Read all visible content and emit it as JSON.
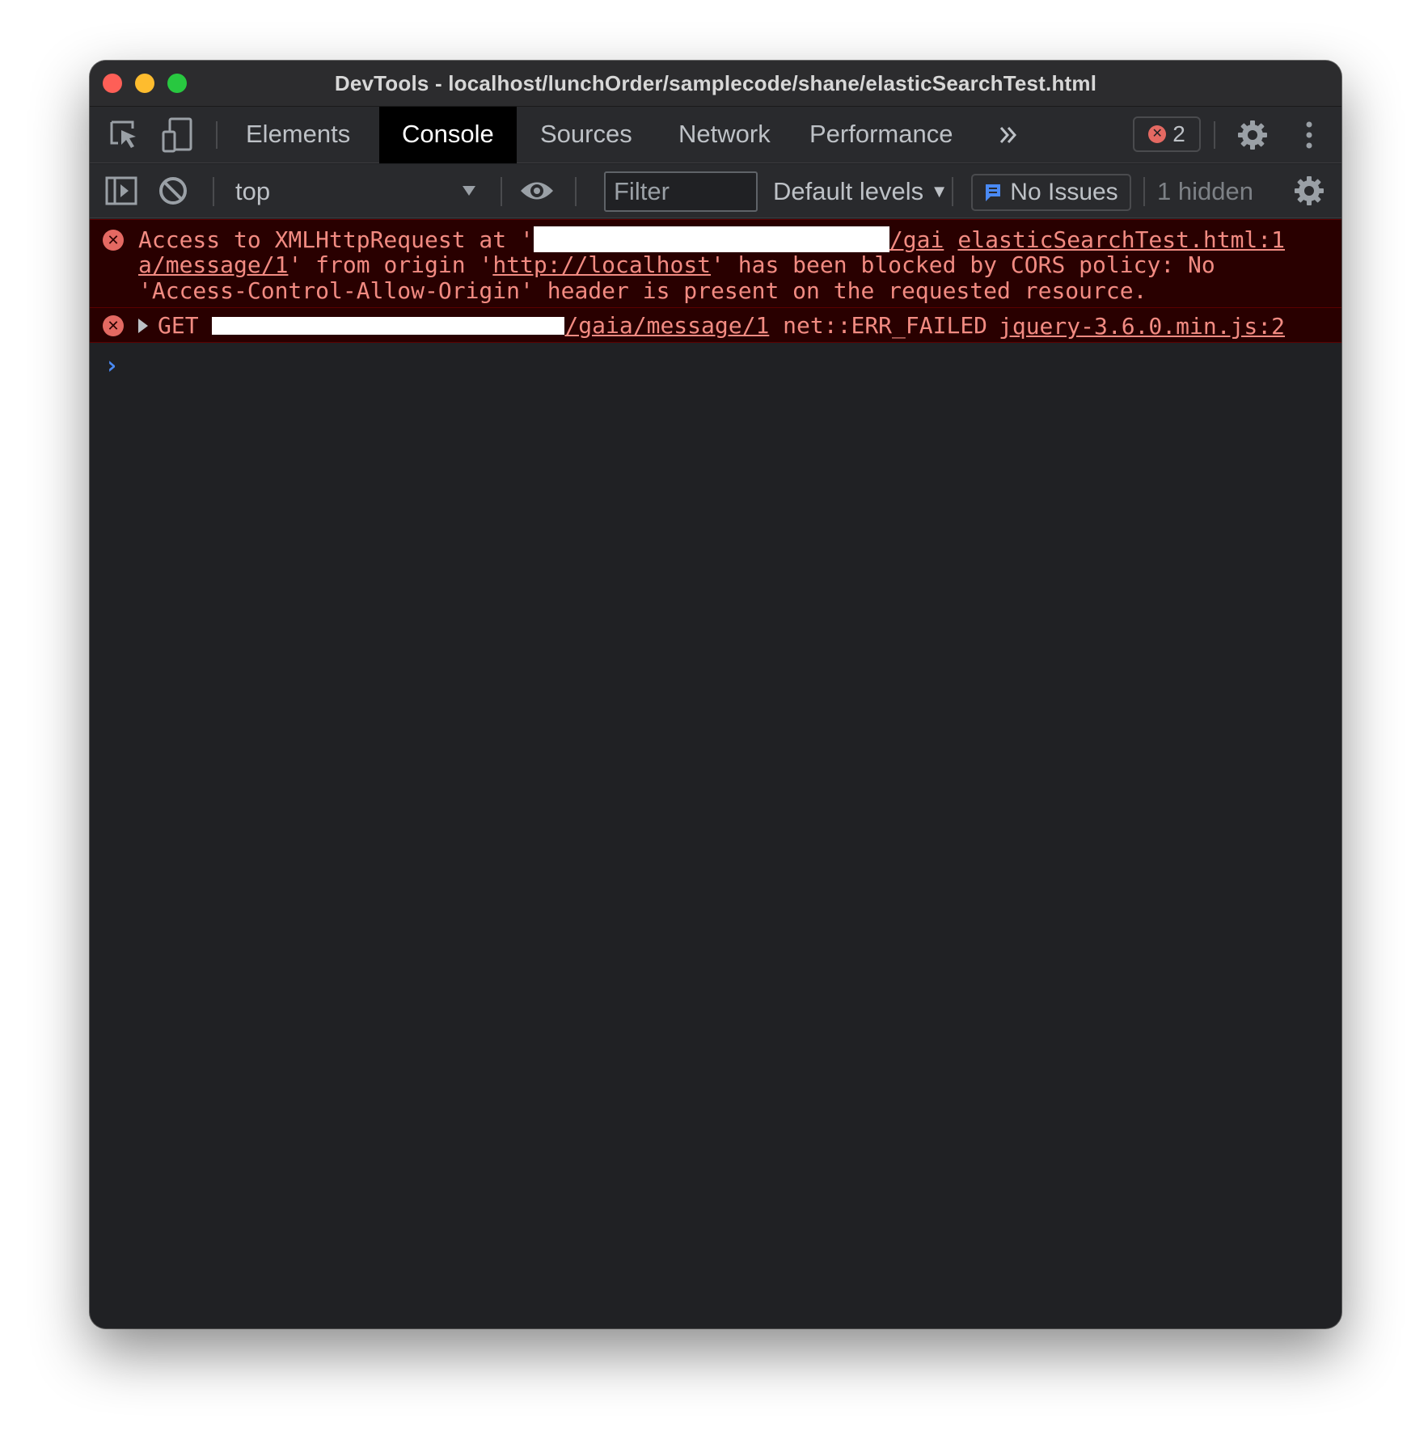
{
  "window": {
    "title": "DevTools - localhost/lunchOrder/samplecode/shane/elasticSearchTest.html"
  },
  "tabs": [
    {
      "label": "Elements",
      "active": false
    },
    {
      "label": "Console",
      "active": true
    },
    {
      "label": "Sources",
      "active": false
    },
    {
      "label": "Network",
      "active": false
    },
    {
      "label": "Performance",
      "active": false
    }
  ],
  "toolbar": {
    "more_tabs_icon": "chevrons-right-icon",
    "error_count": "2",
    "context": "top",
    "filter_placeholder": "Filter",
    "levels": "Default levels",
    "issues": "No Issues",
    "hidden": "1 hidden"
  },
  "messages": [
    {
      "level": "error",
      "line1_prefix": "Access to XMLHttpRequest at '",
      "line1_url_tail": "/gai",
      "line2_url": "a/message/1",
      "line2_mid": "' from origin '",
      "line2_origin": "http://localhost",
      "line2_suffix": "' has been blocked by CORS policy: No",
      "line3": "'Access-Control-Allow-Origin' header is present on the requested resource.",
      "source": "elasticSearchTest.html:1"
    },
    {
      "level": "error",
      "method": "GET",
      "url_tail": "/gaia/message/1",
      "error": "net::ERR_FAILED",
      "source": "jquery-3.6.0.min.js:2"
    }
  ],
  "colors": {
    "panel_bg": "#202124",
    "error_bg": "#290000",
    "error_text": "#f28b82",
    "accent_blue": "#4a8af4"
  }
}
